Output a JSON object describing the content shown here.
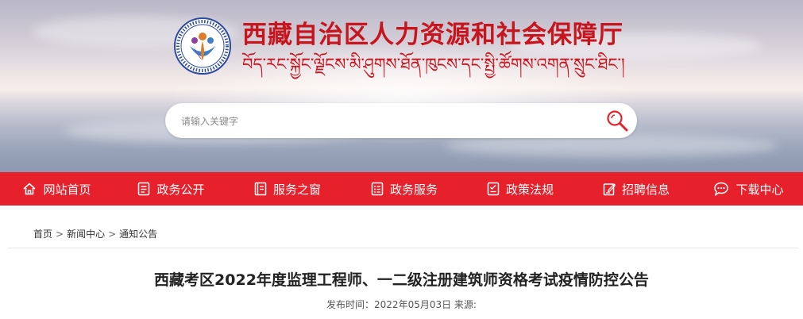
{
  "header": {
    "title_cn": "西藏自治区人力资源和社会保障厅",
    "title_tibetan": "བོད་རང་སྐྱོང་ལྗོངས་མི་ཤུགས་ཐོན་ཁུངས་དང་སྤྱི་ཚོགས་འགན་སྲུང་ཐིང་།",
    "search": {
      "placeholder": "请输入关键字"
    }
  },
  "nav": {
    "items": [
      {
        "label": "网站首页",
        "icon": "home-icon"
      },
      {
        "label": "政务公开",
        "icon": "document-icon"
      },
      {
        "label": "服务之窗",
        "icon": "notebook-icon"
      },
      {
        "label": "政务服务",
        "icon": "list-icon"
      },
      {
        "label": "政策法规",
        "icon": "checklist-icon"
      },
      {
        "label": "招聘信息",
        "icon": "edit-icon"
      },
      {
        "label": "下载中心",
        "icon": "chat-icon"
      }
    ]
  },
  "breadcrumb": {
    "items": [
      "首页",
      "新闻中心",
      "通知公告"
    ],
    "separator": ">"
  },
  "article": {
    "title": "西藏考区2022年度监理工程师、一二级注册建筑师资格考试疫情防控公告",
    "meta": "发布时间：2022年05月03日 来源:"
  },
  "colors": {
    "brand_red": "#e6212b",
    "title_red": "#c8141c"
  }
}
